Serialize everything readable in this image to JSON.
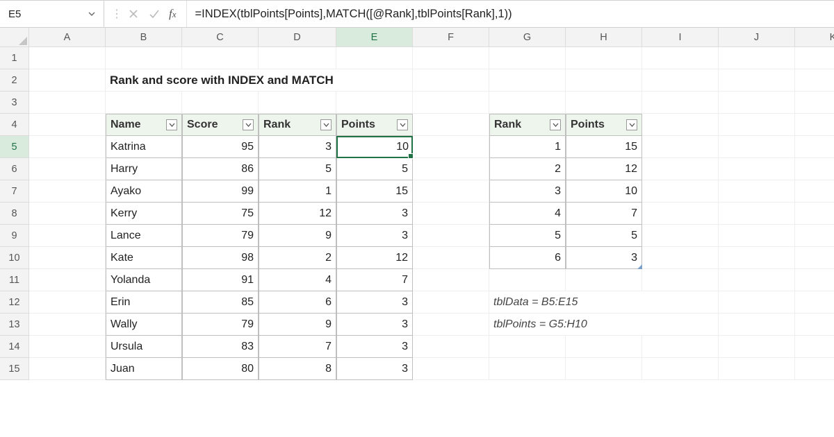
{
  "name_box": "E5",
  "formula": "=INDEX(tblPoints[Points],MATCH([@Rank],tblPoints[Rank],1))",
  "columns": [
    "A",
    "B",
    "C",
    "D",
    "E",
    "F",
    "G",
    "H",
    "I",
    "J",
    "K"
  ],
  "rows": [
    "1",
    "2",
    "3",
    "4",
    "5",
    "6",
    "7",
    "8",
    "9",
    "10",
    "11",
    "12",
    "13",
    "14",
    "15"
  ],
  "title": "Rank and score with INDEX and MATCH",
  "tblData": {
    "headers": [
      "Name",
      "Score",
      "Rank",
      "Points"
    ],
    "rows": [
      {
        "name": "Katrina",
        "score": 95,
        "rank": 3,
        "points": 10
      },
      {
        "name": "Harry",
        "score": 86,
        "rank": 5,
        "points": 5
      },
      {
        "name": "Ayako",
        "score": 99,
        "rank": 1,
        "points": 15
      },
      {
        "name": "Kerry",
        "score": 75,
        "rank": 12,
        "points": 3
      },
      {
        "name": "Lance",
        "score": 79,
        "rank": 9,
        "points": 3
      },
      {
        "name": "Kate",
        "score": 98,
        "rank": 2,
        "points": 12
      },
      {
        "name": "Yolanda",
        "score": 91,
        "rank": 4,
        "points": 7
      },
      {
        "name": "Erin",
        "score": 85,
        "rank": 6,
        "points": 3
      },
      {
        "name": "Wally",
        "score": 79,
        "rank": 9,
        "points": 3
      },
      {
        "name": "Ursula",
        "score": 83,
        "rank": 7,
        "points": 3
      },
      {
        "name": "Juan",
        "score": 80,
        "rank": 8,
        "points": 3
      }
    ]
  },
  "tblPoints": {
    "headers": [
      "Rank",
      "Points"
    ],
    "rows": [
      {
        "rank": 1,
        "points": 15
      },
      {
        "rank": 2,
        "points": 12
      },
      {
        "rank": 3,
        "points": 10
      },
      {
        "rank": 4,
        "points": 7
      },
      {
        "rank": 5,
        "points": 5
      },
      {
        "rank": 6,
        "points": 3
      }
    ]
  },
  "notes": {
    "tblData": "tblData = B5:E15",
    "tblPoints": "tblPoints = G5:H10"
  },
  "selected_cell": "E5",
  "selected_col": "E",
  "selected_row": "5"
}
